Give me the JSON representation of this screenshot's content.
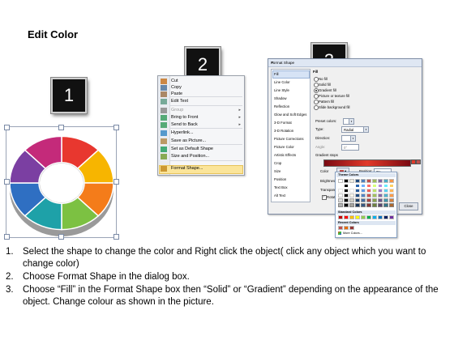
{
  "title": "Edit Color",
  "steps": [
    "1",
    "2",
    "3"
  ],
  "context_menu": {
    "items": [
      "Cut",
      "Copy",
      "Paste",
      "Edit Text",
      "Group",
      "Bring to Front",
      "Send to Back",
      "Hyperlink...",
      "Save as Picture...",
      "Set as Default Shape",
      "Size and Position...",
      "Format Shape..."
    ],
    "highlighted": "Format Shape..."
  },
  "dialog": {
    "title": "Format Shape",
    "categories": [
      "Fill",
      "Line Color",
      "Line Style",
      "Shadow",
      "Reflection",
      "Glow and Soft Edges",
      "3-D Format",
      "3-D Rotation",
      "Picture Corrections",
      "Picture Color",
      "Artistic Effects",
      "Crop",
      "Size",
      "Position",
      "Text Box",
      "Alt Text"
    ],
    "selected_category": "Fill",
    "section": "Fill",
    "fill_options": [
      "No fill",
      "Solid fill",
      "Gradient fill",
      "Picture or texture fill",
      "Pattern fill",
      "Slide background fill"
    ],
    "selected_fill": "Gradient fill",
    "fields": {
      "preset_colors": "Preset colors:",
      "type_label": "Type:",
      "type_value": "Radial",
      "direction_label": "Direction:",
      "angle_label": "Angle:",
      "angle_value": "0°",
      "gradient_stops": "Gradient stops",
      "color_label": "Color",
      "position_label": "Position:",
      "position_value": "0%",
      "brightness_label": "Brightness:",
      "transparency_label": "Transparency:",
      "rotate_label": "Rotate with shape"
    },
    "close_button": "Close"
  },
  "palette": {
    "theme_header": "Theme Colors",
    "standard_header": "Standard Colors",
    "recent_header": "Recent Colors",
    "more_label": "More Colors...",
    "theme_row": [
      "#ffffff",
      "#000000",
      "#eeece1",
      "#1f497d",
      "#4f81bd",
      "#c0504d",
      "#9bbb59",
      "#8064a2",
      "#4bacc6",
      "#f79646"
    ],
    "standard_row": [
      "#c00000",
      "#ff0000",
      "#ffc000",
      "#ffff00",
      "#92d050",
      "#00b050",
      "#00b0f0",
      "#0070c0",
      "#002060",
      "#7030a0"
    ],
    "recent_row": [
      "#c0504d",
      "#e46c0a",
      "#953735"
    ]
  },
  "instructions": [
    {
      "num": "1.",
      "text": "Select the shape to change the color and Right click the object( click any object which you want to change color)"
    },
    {
      "num": "2.",
      "text": "Choose Format Shape in the dialog box."
    },
    {
      "num": "3.",
      "text": "Choose “Fill” in the Format Shape box then “Solid” or “Gradient” depending on the appearance of the object. Change colour as shown in the picture."
    }
  ],
  "colors": {
    "donut": [
      "#e8372f",
      "#f7b500",
      "#f47c1a",
      "#7cc142",
      "#1ea1a8",
      "#2f6fc2",
      "#7b3fa2",
      "#c42a7a"
    ]
  }
}
